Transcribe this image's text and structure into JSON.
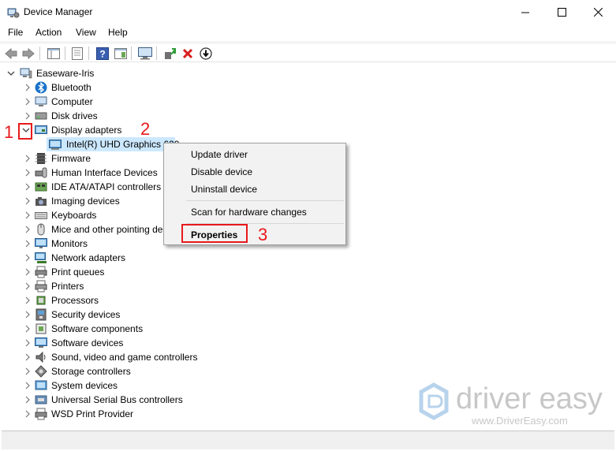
{
  "window": {
    "title": "Device Manager"
  },
  "menu": [
    "File",
    "Action",
    "View",
    "Help"
  ],
  "tree": {
    "root": "Easeware-Iris",
    "categories": [
      {
        "label": "Bluetooth",
        "icon": "bluetooth-icon"
      },
      {
        "label": "Computer",
        "icon": "computer-icon"
      },
      {
        "label": "Disk drives",
        "icon": "disk-drive-icon"
      },
      {
        "label": "Display adapters",
        "icon": "display-adapter-icon",
        "expanded": true
      },
      {
        "label": "Firmware",
        "icon": "firmware-icon"
      },
      {
        "label": "Human Interface Devices",
        "icon": "hid-icon"
      },
      {
        "label": "IDE ATA/ATAPI controllers",
        "icon": "ide-controller-icon"
      },
      {
        "label": "Imaging devices",
        "icon": "camera-icon"
      },
      {
        "label": "Keyboards",
        "icon": "keyboard-icon"
      },
      {
        "label": "Mice and other pointing de",
        "icon": "mouse-icon"
      },
      {
        "label": "Monitors",
        "icon": "monitor-icon"
      },
      {
        "label": "Network adapters",
        "icon": "network-adapter-icon"
      },
      {
        "label": "Print queues",
        "icon": "print-queue-icon"
      },
      {
        "label": "Printers",
        "icon": "printer-icon"
      },
      {
        "label": "Processors",
        "icon": "processor-icon"
      },
      {
        "label": "Security devices",
        "icon": "security-device-icon"
      },
      {
        "label": "Software components",
        "icon": "software-component-icon"
      },
      {
        "label": "Software devices",
        "icon": "software-device-icon"
      },
      {
        "label": "Sound, video and game controllers",
        "icon": "speaker-icon"
      },
      {
        "label": "Storage controllers",
        "icon": "storage-controller-icon"
      },
      {
        "label": "System devices",
        "icon": "system-device-icon"
      },
      {
        "label": "Universal Serial Bus controllers",
        "icon": "usb-icon"
      },
      {
        "label": "WSD Print Provider",
        "icon": "wsd-printer-icon"
      }
    ],
    "child": "Intel(R) UHD Graphics 620"
  },
  "context_menu": {
    "items": [
      "Update driver",
      "Disable device",
      "Uninstall device",
      "Scan for hardware changes",
      "Properties"
    ]
  },
  "annotations": [
    "1",
    "2",
    "3"
  ],
  "watermark": {
    "brand": "driver easy",
    "url": "www.DriverEasy.com"
  },
  "colors": {
    "annotation_red": "#e8191b",
    "selection_blue": "#cce8ff",
    "context_bg": "#f2f2f2"
  }
}
